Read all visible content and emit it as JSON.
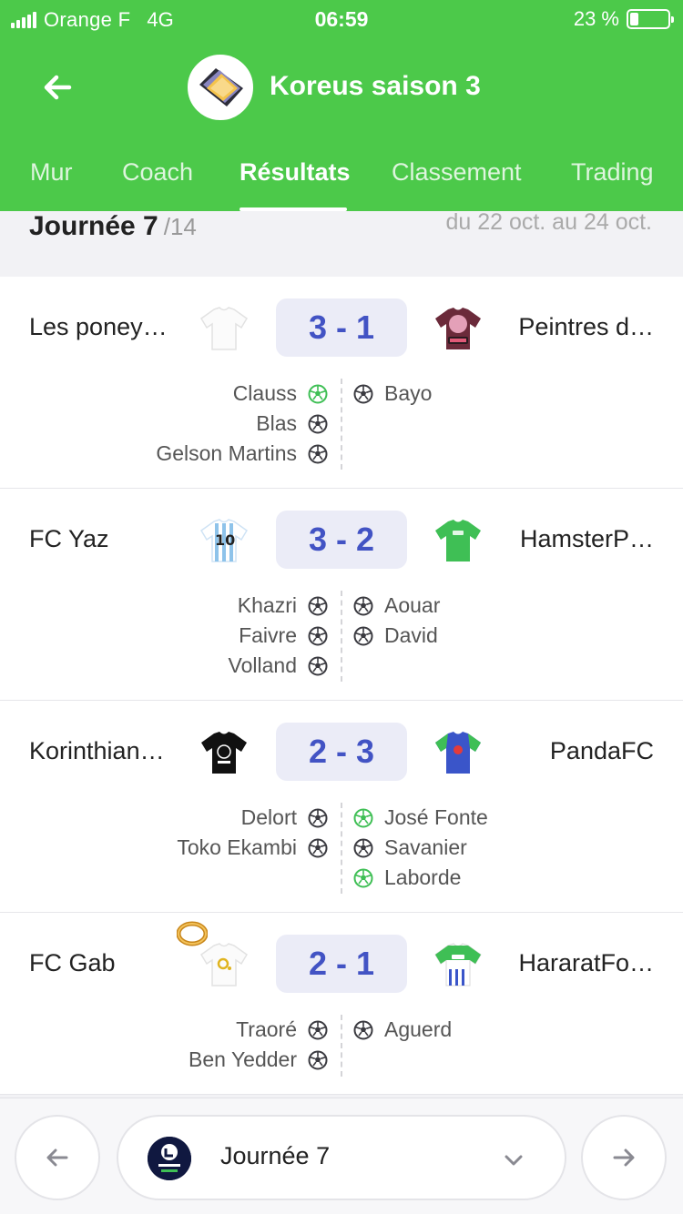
{
  "status_bar": {
    "carrier": "Orange F",
    "network": "4G",
    "time": "06:59",
    "battery_text": "23 %",
    "battery_level": 0.23
  },
  "header": {
    "title": "Koreus saison 3",
    "background_color": "#4cc94a"
  },
  "tabs": [
    {
      "label": "Mur",
      "active": false
    },
    {
      "label": "Coach",
      "active": false
    },
    {
      "label": "Résultats",
      "active": true
    },
    {
      "label": "Classement",
      "active": false
    },
    {
      "label": "Trading",
      "active": false
    }
  ],
  "day": {
    "title": "Journée 7",
    "total": "/14",
    "range": "du 22 oct. au 24 oct."
  },
  "matches": [
    {
      "home": "Les poney…",
      "away": "Peintres d…",
      "score": "3 - 1",
      "home_jersey": "white-jersey-icon",
      "away_jersey": "pink-jersey-icon",
      "home_scorers": [
        {
          "name": "Clauss",
          "ball": "green"
        },
        {
          "name": "Blas",
          "ball": "dark"
        },
        {
          "name": "Gelson Martins",
          "ball": "dark"
        }
      ],
      "away_scorers": [
        {
          "name": "Bayo",
          "ball": "dark"
        }
      ]
    },
    {
      "home": "FC Yaz",
      "away": "HamsterP…",
      "score": "3 - 2",
      "home_jersey": "argentina-jersey-icon",
      "away_jersey": "green-jersey-icon",
      "home_scorers": [
        {
          "name": "Khazri",
          "ball": "dark"
        },
        {
          "name": "Faivre",
          "ball": "dark"
        },
        {
          "name": "Volland",
          "ball": "dark"
        }
      ],
      "away_scorers": [
        {
          "name": "Aouar",
          "ball": "dark"
        },
        {
          "name": "David",
          "ball": "dark"
        }
      ]
    },
    {
      "home": "Korinthian…",
      "away": "PandaFC",
      "score": "2 - 3",
      "home_jersey": "black-jersey-icon",
      "away_jersey": "blue-jersey-icon",
      "home_scorers": [
        {
          "name": "Delort",
          "ball": "dark"
        },
        {
          "name": "Toko Ekambi",
          "ball": "dark"
        }
      ],
      "away_scorers": [
        {
          "name": "José Fonte",
          "ball": "green"
        },
        {
          "name": "Savanier",
          "ball": "dark"
        },
        {
          "name": "Laborde",
          "ball": "green"
        }
      ]
    },
    {
      "home": "FC Gab",
      "away": "HararatFo…",
      "score": "2 - 1",
      "home_jersey": "white-o2-jersey-icon",
      "away_jersey": "mpg-jersey-icon",
      "home_scorers": [
        {
          "name": "Traoré",
          "ball": "dark"
        },
        {
          "name": "Ben Yedder",
          "ball": "dark"
        }
      ],
      "away_scorers": [
        {
          "name": "Aguerd",
          "ball": "dark"
        }
      ]
    }
  ],
  "bottom_nav": {
    "day_select_label": "Journée 7",
    "prev_icon": "arrow-left-icon",
    "next_icon": "arrow-right-icon"
  },
  "colors": {
    "accent": "#4cc94a",
    "score_text": "#4253c4",
    "score_bg": "#ebecf7"
  }
}
